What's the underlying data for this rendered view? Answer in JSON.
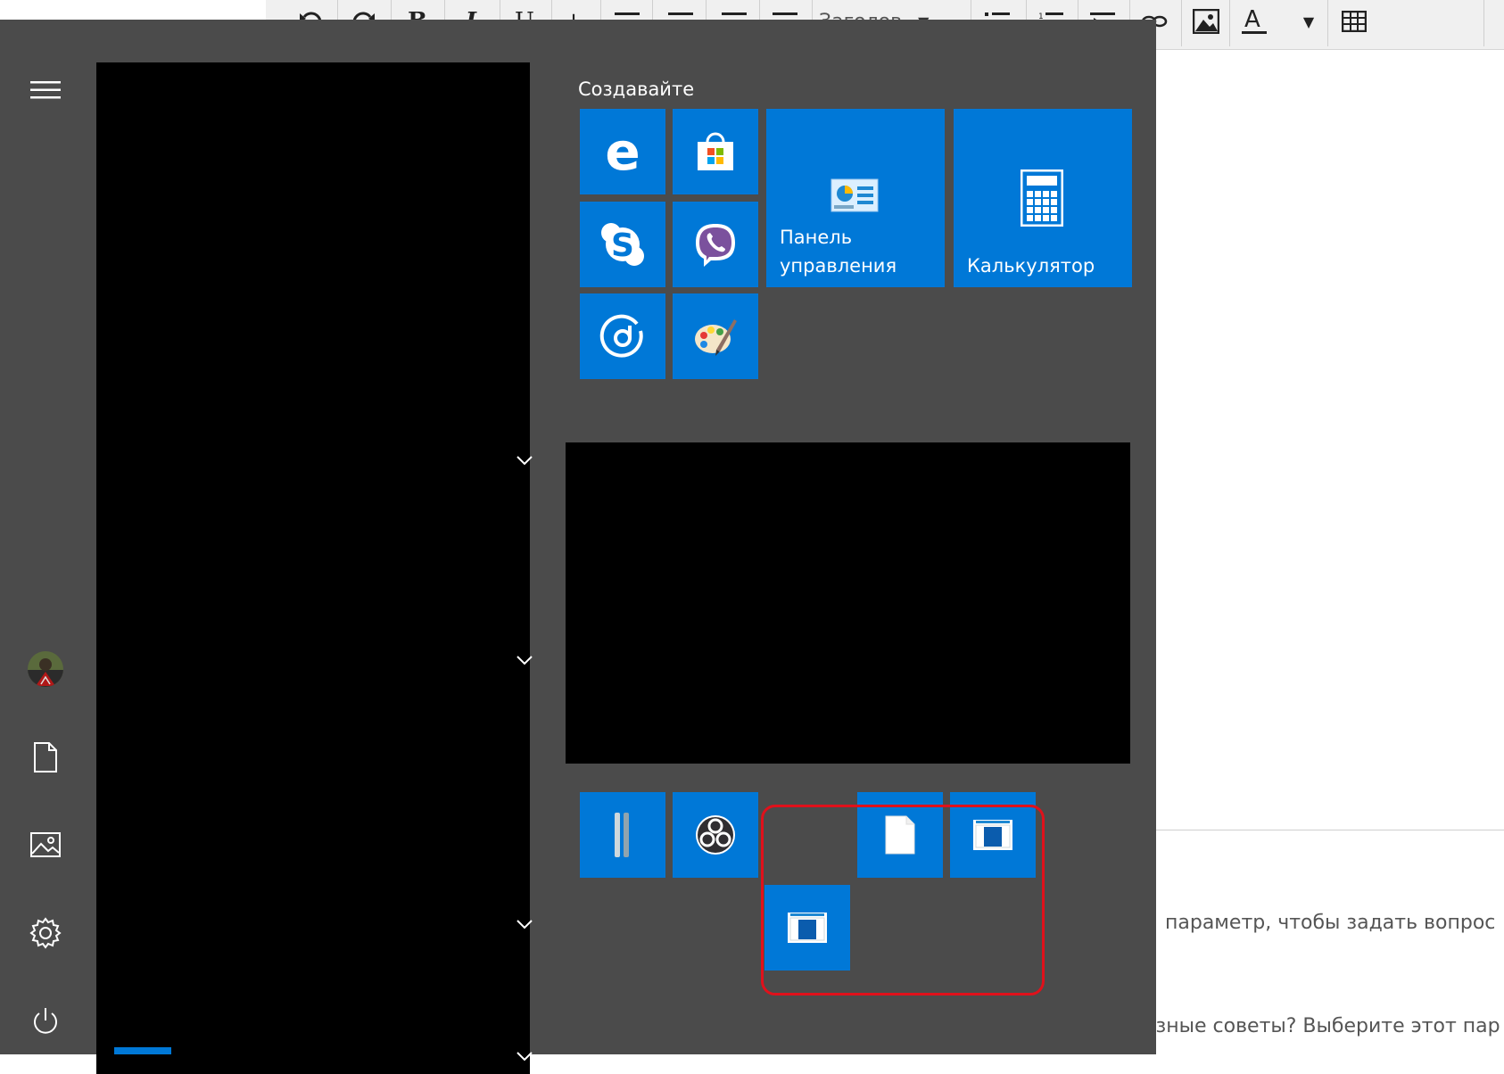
{
  "editor": {
    "toolbar_items": [
      "undo-icon",
      "redo-icon",
      "bold-icon",
      "italic-icon",
      "underline-icon",
      "strike-icon",
      "align-left-icon",
      "align-center-icon",
      "align-right-icon",
      "align-justify-icon",
      "heading-dropdown",
      "bullet-list-icon",
      "numbered-list-icon",
      "indent-icon",
      "link-icon",
      "image-icon",
      "text-color-icon",
      "dropdown-arrow-icon",
      "table-icon"
    ],
    "heading_label": "Заголов",
    "hint_line_1": "параметр, чтобы задать вопрос",
    "hint_line_2": "езные советы? Выберите этот пар"
  },
  "start_menu": {
    "group_title": "Создавайте",
    "rail": {
      "menu_icon": "hamburger-icon",
      "avatar": "avatar",
      "items": [
        "documents-icon",
        "pictures-icon",
        "settings-icon",
        "power-icon"
      ]
    },
    "tiles": [
      {
        "name": "edge",
        "icon": "edge-icon",
        "label": ""
      },
      {
        "name": "store",
        "icon": "store-icon",
        "label": ""
      },
      {
        "name": "control-panel",
        "icon": "control-panel-icon",
        "label": "Панель\nуправления"
      },
      {
        "name": "calculator",
        "icon": "calculator-icon",
        "label": "Калькулятор"
      },
      {
        "name": "skype",
        "icon": "skype-icon",
        "label": ""
      },
      {
        "name": "viber",
        "icon": "viber-icon",
        "label": ""
      },
      {
        "name": "groove",
        "icon": "groove-music-icon",
        "label": ""
      },
      {
        "name": "paint",
        "icon": "paint-icon",
        "label": ""
      },
      {
        "name": "app-1",
        "icon": "app-icon",
        "label": ""
      },
      {
        "name": "obs",
        "icon": "obs-icon",
        "label": ""
      },
      {
        "name": "blank-document",
        "icon": "document-icon",
        "label": ""
      },
      {
        "name": "window-app-1",
        "icon": "window-icon",
        "label": ""
      },
      {
        "name": "window-app-2",
        "icon": "window-icon",
        "label": ""
      }
    ],
    "colors": {
      "tile": "#0078d7",
      "background": "#4b4b4b",
      "highlight": "#e0111b"
    }
  }
}
